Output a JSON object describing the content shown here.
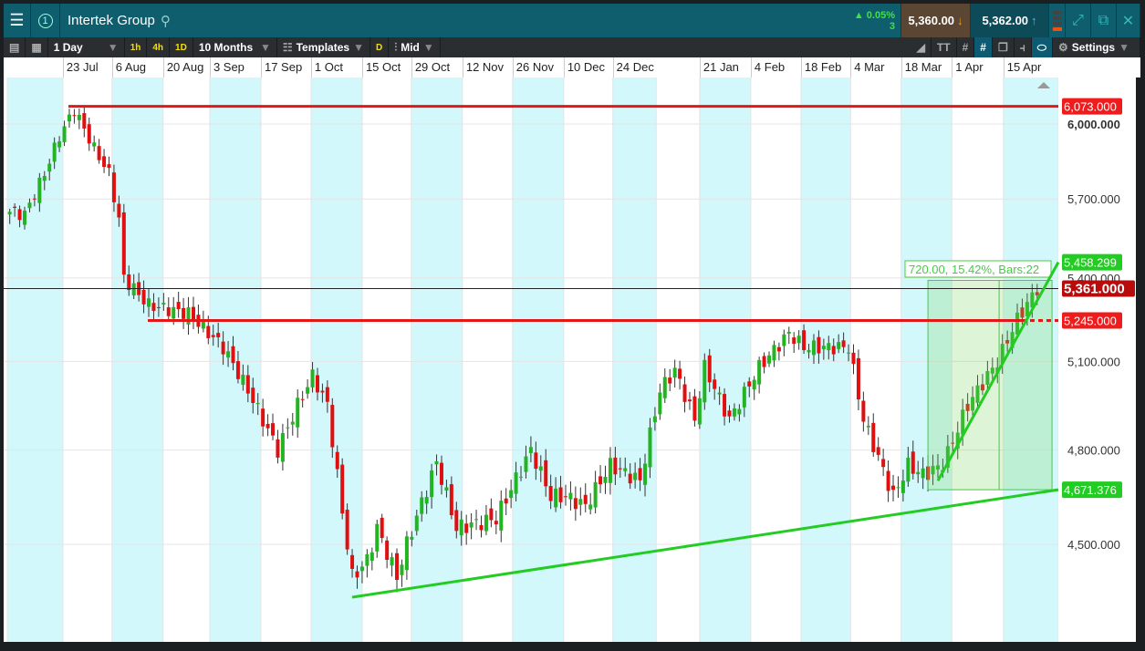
{
  "header": {
    "title": "Intertek Group",
    "slot": "1",
    "change_pct": "0.05%",
    "change_count": "3",
    "sell": "5,360.00",
    "buy": "5,362.00"
  },
  "toolbar": {
    "interval": "1 Day",
    "q1": "1h",
    "q2": "4h",
    "q3": "1D",
    "range": "10 Months",
    "templates": "Templates",
    "d": "D",
    "price_type": "Mid",
    "settings": "Settings"
  },
  "colors": {
    "up": "#22b422",
    "down": "#e01010",
    "band": "#d3f8fb",
    "red_line": "#e01818",
    "green_line": "#22cc22"
  },
  "chart_data": {
    "type": "candlestick",
    "instrument": "Intertek Group",
    "x_ticks": [
      {
        "label": "23 Jul",
        "bar": 11.2
      },
      {
        "label": "6 Aug",
        "bar": 21.1
      },
      {
        "label": "20 Aug",
        "bar": 31.4
      },
      {
        "label": "3 Sep",
        "bar": 40.8
      },
      {
        "label": "17 Sep",
        "bar": 51.1
      },
      {
        "label": "1 Oct",
        "bar": 61.2
      },
      {
        "label": "15 Oct",
        "bar": 71.5
      },
      {
        "label": "29 Oct",
        "bar": 81.4
      },
      {
        "label": "12 Nov",
        "bar": 91.7
      },
      {
        "label": "26 Nov",
        "bar": 101.8
      },
      {
        "label": "10 Dec",
        "bar": 112.1
      },
      {
        "label": "24 Dec",
        "bar": 122
      },
      {
        "label": "21 Jan",
        "bar": 139.5
      },
      {
        "label": "4 Feb",
        "bar": 149.8
      },
      {
        "label": "18 Feb",
        "bar": 159.9
      },
      {
        "label": "4 Mar",
        "bar": 169.9
      },
      {
        "label": "18 Mar",
        "bar": 180.1
      },
      {
        "label": "1 Apr",
        "bar": 190.3
      },
      {
        "label": "15 Apr",
        "bar": 200.7
      }
    ],
    "y_ticks": [
      "6,000.000",
      "5,700.000",
      "5,400.000",
      "5,100.000",
      "4,800.000",
      "4,500.000"
    ],
    "y_tick_values": [
      6000,
      5700,
      5400,
      5100,
      4800,
      4500
    ],
    "ylim": [
      4300,
      6150
    ],
    "scale": "log",
    "close_path": [
      [
        0,
        5650
      ],
      [
        3,
        5640
      ],
      [
        7,
        5800
      ],
      [
        10,
        5950
      ],
      [
        13,
        6060
      ],
      [
        17,
        5900
      ],
      [
        20,
        5800
      ],
      [
        22,
        5620
      ],
      [
        23,
        5400
      ],
      [
        28,
        5300
      ],
      [
        36,
        5270
      ],
      [
        43,
        5150
      ],
      [
        48,
        5000
      ],
      [
        54,
        4800
      ],
      [
        58,
        4950
      ],
      [
        61,
        5050
      ],
      [
        64,
        4950
      ],
      [
        67,
        4600
      ],
      [
        69,
        4400
      ],
      [
        72,
        4450
      ],
      [
        74,
        4550
      ],
      [
        78,
        4400
      ],
      [
        80,
        4500
      ],
      [
        86,
        4760
      ],
      [
        90,
        4550
      ],
      [
        98,
        4580
      ],
      [
        105,
        4800
      ],
      [
        109,
        4650
      ],
      [
        112,
        4650
      ],
      [
        116,
        4620
      ],
      [
        121,
        4750
      ],
      [
        127,
        4700
      ],
      [
        131,
        5000
      ],
      [
        134,
        5070
      ],
      [
        138,
        4900
      ],
      [
        140,
        5080
      ],
      [
        145,
        4900
      ],
      [
        151,
        5080
      ],
      [
        157,
        5200
      ],
      [
        160,
        5150
      ],
      [
        164,
        5150
      ],
      [
        169,
        5150
      ],
      [
        172,
        4900
      ],
      [
        178,
        4650
      ],
      [
        181,
        4750
      ],
      [
        184,
        4720
      ],
      [
        188,
        4750
      ],
      [
        193,
        4950
      ],
      [
        199,
        5100
      ],
      [
        203,
        5250
      ],
      [
        207,
        5361
      ]
    ],
    "levels": [
      {
        "label": "6,073.000",
        "value": 6073,
        "color": "red"
      },
      {
        "label": "5,245.000",
        "value": 5245,
        "color": "red"
      },
      {
        "label": "5,361.000",
        "value": 5361,
        "color": "darkred"
      },
      {
        "label": "5,458.299",
        "value": 5458.299,
        "color": "green"
      },
      {
        "label": "4,671.376",
        "value": 4671.376,
        "color": "green"
      }
    ],
    "trendlines": [
      {
        "from": [
          69,
          4340
        ],
        "to": [
          211,
          4671.376
        ]
      },
      {
        "from": [
          187,
          4700
        ],
        "to": [
          211,
          5458.299
        ]
      }
    ],
    "measure": {
      "label": "720.00, 15.42%, Bars:22",
      "from_bar": 185,
      "to_bar": 210,
      "low": 4671.376,
      "high": 5391
    }
  }
}
